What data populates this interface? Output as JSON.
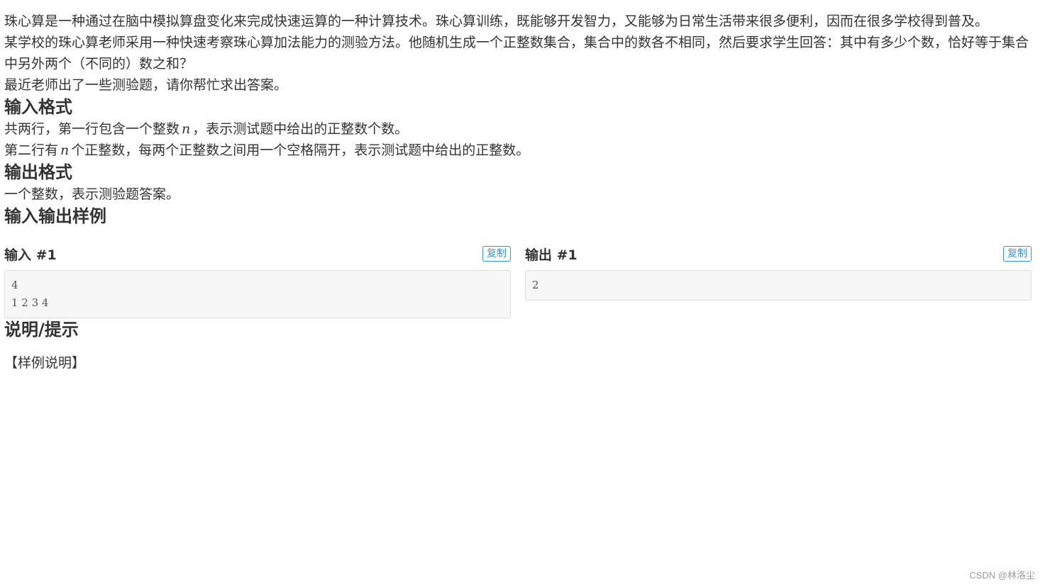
{
  "intro": {
    "p1": "珠心算是一种通过在脑中模拟算盘变化来完成快速运算的一种计算技术。珠心算训练，既能够开发智力，又能够为日常生活带来很多便利，因而在很多学校得到普及。",
    "p2": "某学校的珠心算老师采用一种快速考察珠心算加法能力的测验方法。他随机生成一个正整数集合，集合中的数各不相同，然后要求学生回答：其中有多少个数，恰好等于集合中另外两个（不同的）数之和？",
    "p3": "最近老师出了一些测验题，请你帮忙求出答案。"
  },
  "input_format": {
    "title": "输入格式",
    "line1_before": "共两行，第一行包含一个整数",
    "line1_var": "n",
    "line1_after": "，表示测试题中给出的正整数个数。",
    "line2_before": "第二行有",
    "line2_var": "n",
    "line2_after": "个正整数，每两个正整数之间用一个空格隔开，表示测试题中给出的正整数。"
  },
  "output_format": {
    "title": "输出格式",
    "text": "一个整数，表示测验题答案。"
  },
  "samples": {
    "title": "输入输出样例",
    "input": {
      "label": "输入 #1",
      "copy_label": "复制",
      "content": "4\n1 2 3 4"
    },
    "output": {
      "label": "输出 #1",
      "copy_label": "复制",
      "content": "2"
    }
  },
  "hint": {
    "title": "说明/提示",
    "text": "【样例说明】"
  },
  "watermark": "CSDN @林洛尘"
}
